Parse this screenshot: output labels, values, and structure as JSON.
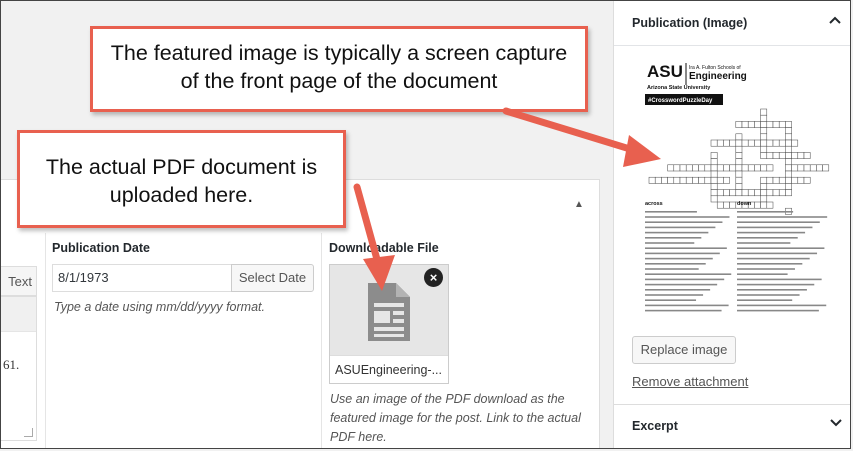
{
  "editor": {
    "text_tab": "Text",
    "body_fragment": "61."
  },
  "publication_date": {
    "label": "Publication Date",
    "value": "8/1/1973",
    "button": "Select Date",
    "hint": "Type a date using mm/dd/yyyy format."
  },
  "downloadable_file": {
    "label": "Downloadable File",
    "file_name": "ASUEngineering-...",
    "hint": "Use an image of the PDF download as the featured image for the post. Link to the actual PDF here."
  },
  "sidebar": {
    "publication_image": {
      "title": "Publication (Image)",
      "replace_button": "Replace image",
      "remove_link": "Remove attachment"
    },
    "excerpt": {
      "title": "Excerpt"
    }
  },
  "thumbnail": {
    "logo_line1": "ASU",
    "logo_line2a": "Ira A. Fulton Schools of",
    "logo_line2b": "Engineering",
    "logo_line3": "Arizona State University",
    "tag": "#CrosswordPuzzleDay",
    "across_title": "across",
    "down_title": "down"
  },
  "callouts": {
    "featured": "The featured image is typically a screen capture of the front page of the document",
    "pdf": "The actual PDF document is uploaded here."
  },
  "colors": {
    "callout_border": "#e8604f",
    "arrow": "#e8604f",
    "accent_dark": "#23282d"
  }
}
